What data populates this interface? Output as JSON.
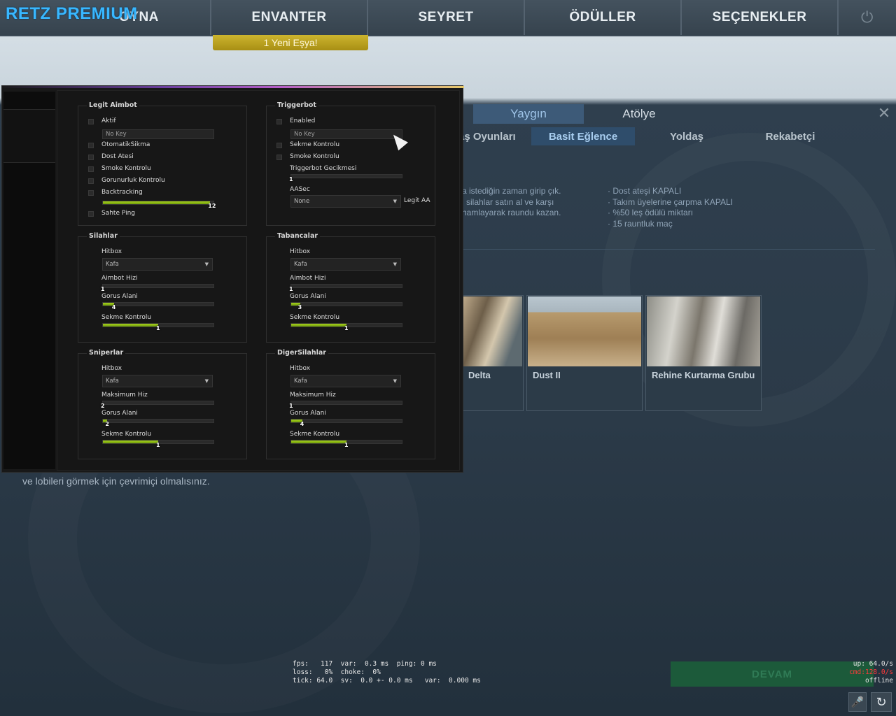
{
  "brand": "RETZ PREMIUM",
  "nav": {
    "play": "OYNA",
    "inventory": "ENVANTER",
    "watch": "SEYRET",
    "rewards": "ÖDÜLLER",
    "options": "SEÇENEKLER",
    "power_icon": "⏻",
    "new_item": "1 Yeni Eşya!"
  },
  "play": {
    "tabs": [
      "Yaygın",
      "Atölye"
    ],
    "close_icon": "✕",
    "modes": [
      "aş Oyunları",
      "Basit Eğlence",
      "Yoldaş",
      "Rekabetçi"
    ],
    "description": [
      "a istediğin zaman girip çık.",
      "i silahlar satın al ve karşı",
      "hamlayarak raundu kazan."
    ],
    "rules": [
      "· Dost ateşi KAPALI",
      "· Takım üyelerine çarpma KAPALI",
      "· %50 leş ödülü miktarı",
      "· 15 rauntluk maç"
    ],
    "maps": [
      "Delta",
      "Dust II",
      "Rehine Kurtarma Grubu"
    ],
    "offline_message": "ve lobileri görmek için çevrimiçi olmalısınız.",
    "continue": "DEVAM"
  },
  "netgraph": {
    "line1": "fps:   117  var:  0.3 ms  ping: 0 ms",
    "line2": "loss:   0%  choke:  0%",
    "line3": "tick: 64.0  sv:  0.0 +- 0.0 ms   var:  0.000 ms",
    "up": "up: 64.0/s",
    "cmd": "cmd:128.0/s",
    "status": "offline"
  },
  "icons": {
    "mic": "🎤",
    "refresh": "↻"
  },
  "cheat": {
    "legit_aimbot": {
      "title": "Legit Aimbot",
      "active": "Aktif",
      "key": "No Key",
      "auto_fire": "OtomatikSikma",
      "friendly_fire": "Dost Atesi",
      "smoke_check": "Smoke Kontrolu",
      "visibility_check": "Gorunurluk Kontrolu",
      "backtracking": "Backtracking",
      "backtracking_value": "12",
      "backtracking_fraction": 0.97,
      "fake_ping": "Sahte Ping"
    },
    "triggerbot": {
      "title": "Triggerbot",
      "enabled": "Enabled",
      "key": "No Key",
      "recoil_check": "Sekme Kontrolu",
      "smoke_check": "Smoke Kontrolu",
      "delay_label": "Triggerbot Gecikmesi",
      "delay_value": "1",
      "delay_fraction": 0.0,
      "aa_label": "AASec",
      "aa_value": "None",
      "legit_aa": "Legit AA"
    },
    "weapons": [
      {
        "title": "Silahlar",
        "hitbox_label": "Hitbox",
        "hitbox": "Kafa",
        "s1_label": "Aimbot Hizi",
        "s1_value": "1",
        "s1_fraction": 0.0,
        "s2_label": "Gorus Alani",
        "s2_value": "4",
        "s2_fraction": 0.1,
        "s3_label": "Sekme Kontrolu",
        "s3_value": "1",
        "s3_fraction": 0.5
      },
      {
        "title": "Tabancalar",
        "hitbox_label": "Hitbox",
        "hitbox": "Kafa",
        "s1_label": "Aimbot Hizi",
        "s1_value": "1",
        "s1_fraction": 0.0,
        "s2_label": "Gorus Alani",
        "s2_value": "3",
        "s2_fraction": 0.08,
        "s3_label": "Sekme Kontrolu",
        "s3_value": "1",
        "s3_fraction": 0.5
      },
      {
        "title": "Sniperlar",
        "hitbox_label": "Hitbox",
        "hitbox": "Kafa",
        "s1_label": "Maksimum Hiz",
        "s1_value": "2",
        "s1_fraction": 0.0,
        "s2_label": "Gorus Alani",
        "s2_value": "2",
        "s2_fraction": 0.04,
        "s3_label": "Sekme Kontrolu",
        "s3_value": "1",
        "s3_fraction": 0.5
      },
      {
        "title": "DigerSilahlar",
        "hitbox_label": "Hitbox",
        "hitbox": "Kafa",
        "s1_label": "Maksimum Hiz",
        "s1_value": "1",
        "s1_fraction": 0.0,
        "s2_label": "Gorus Alani",
        "s2_value": "4",
        "s2_fraction": 0.1,
        "s3_label": "Sekme Kontrolu",
        "s3_value": "1",
        "s3_fraction": 0.5
      }
    ]
  }
}
